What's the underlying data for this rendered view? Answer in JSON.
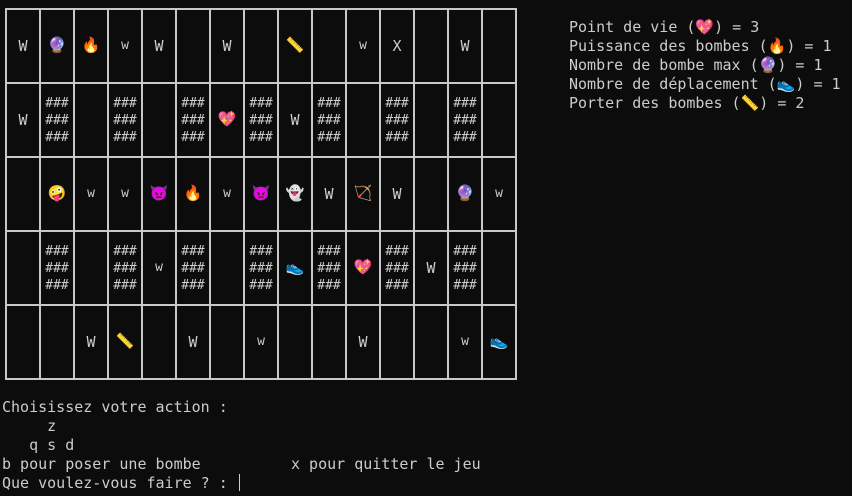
{
  "board": {
    "rows": [
      [
        "W",
        "bomb",
        "fire",
        "w",
        "W",
        "",
        "W",
        "",
        "stick",
        "",
        "w",
        "X",
        "",
        "W",
        ""
      ],
      [
        "W",
        "###",
        "",
        "###",
        "",
        "###",
        "heart",
        "###",
        "W",
        "###",
        "",
        "###",
        "",
        "###",
        ""
      ],
      [
        "",
        "face",
        "w",
        "w",
        "devil",
        "fire",
        "w",
        "devil",
        "ghost",
        "W",
        "bow",
        "W",
        "",
        "bomb",
        "w"
      ],
      [
        "",
        "###",
        "",
        "###",
        "w",
        "###",
        "",
        "###",
        "shoe",
        "###",
        "heart",
        "###",
        "W",
        "###",
        ""
      ],
      [
        "",
        "",
        "W",
        "stick",
        "",
        "W",
        "",
        "w",
        "",
        "",
        "W",
        "",
        "",
        "w",
        "shoe"
      ]
    ]
  },
  "icons": {
    "heart": "💖",
    "fire": "🔥",
    "bomb": "🔮",
    "shoe": "👟",
    "stick": "📏",
    "face": "🤪",
    "devil": "👿",
    "ghost": "👻",
    "bow": "🏹",
    "block": "###\n###\n###"
  },
  "stats": {
    "hp": "Point de vie (💖) = 3",
    "power": "Puissance des bombes (🔥) = 1",
    "max_bombs": "Nombre de bombe max (🔮) = 1",
    "moves": "Nombre de déplacement (👟) = 1",
    "carry": "Porter des bombes (📏) = 2"
  },
  "console": {
    "prompt_title": "Choisissez votre action :",
    "key_up": "     z",
    "keys_row": "   q s d",
    "bomb_hint": "b pour poser une bombe",
    "quit_hint": "x pour quitter le jeu",
    "question": "Que voulez-vous faire ? : "
  },
  "colors": {
    "background": "#0c0c0c",
    "text": "#cccccc",
    "grid_line": "#c8c8c8"
  }
}
